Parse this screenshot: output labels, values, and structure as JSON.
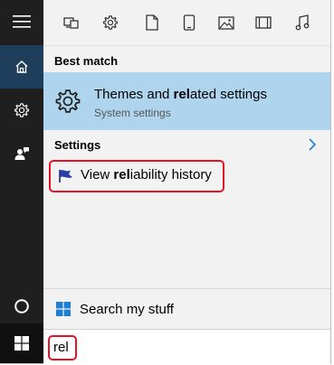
{
  "rail": {
    "items": [
      {
        "icon": "hamburger-menu-icon"
      },
      {
        "icon": "home-icon",
        "active": true
      },
      {
        "icon": "settings-gear-icon"
      },
      {
        "icon": "feedback-person-icon"
      },
      {
        "icon": "cortana-circle-icon"
      },
      {
        "icon": "windows-start-icon"
      }
    ]
  },
  "toolbar": {
    "filters": [
      "apps-filter-icon",
      "settings-filter-icon",
      "documents-filter-icon",
      "folders-filter-icon",
      "photos-filter-icon",
      "videos-filter-icon",
      "music-filter-icon"
    ]
  },
  "best_match": {
    "label": "Best match",
    "title_prefix": "Themes and ",
    "title_bold": "rel",
    "title_suffix": "ated settings",
    "subtitle": "System settings",
    "icon": "gear-icon"
  },
  "settings": {
    "label": "Settings",
    "item_prefix": "View ",
    "item_bold": "rel",
    "item_suffix": "iability history",
    "icon": "flag-icon"
  },
  "search_my_stuff": {
    "label": "Search my stuff",
    "icon": "windows-logo-icon"
  },
  "search_box": {
    "query": "rel"
  },
  "colors": {
    "rail_bg": "#1f1f1f",
    "active_rail": "#1e3e5c",
    "highlight": "#aed4ee",
    "annotation_red": "#e81123",
    "accent_blue": "#1e7fd0"
  }
}
